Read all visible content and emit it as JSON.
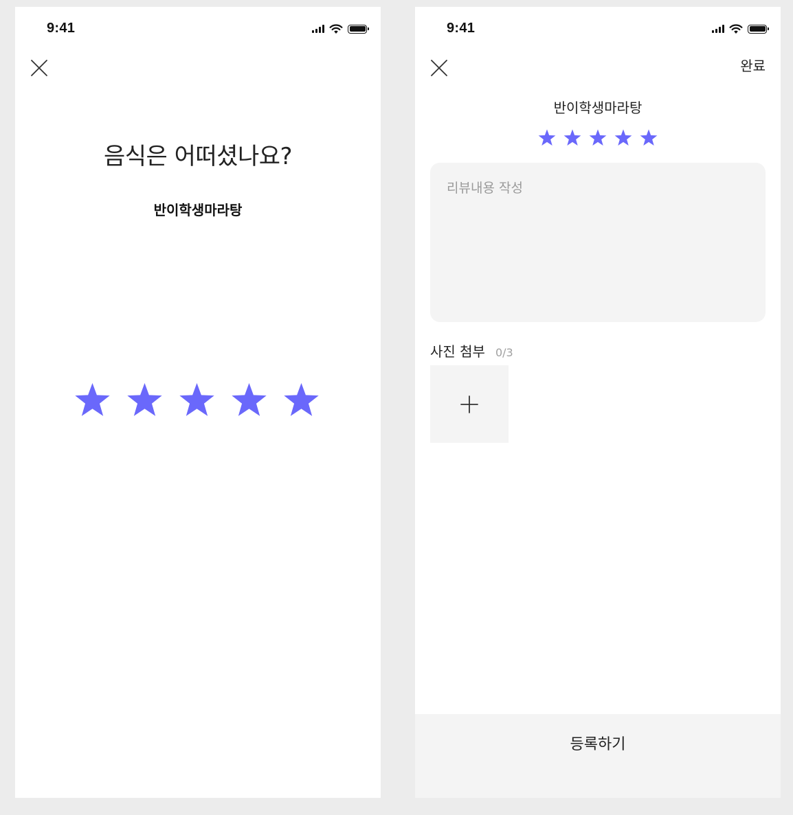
{
  "colors": {
    "star": "#6a68fb",
    "background": "#ececec",
    "surface": "#f4f4f4"
  },
  "left_screen": {
    "status_time": "9:41",
    "question": "음식은 어떠셨나요?",
    "store_name": "반이학생마라탕",
    "rating": 5,
    "max_rating": 5,
    "icons": [
      "close-icon",
      "star-icon",
      "cellular-signal-icon",
      "wifi-icon",
      "battery-icon"
    ]
  },
  "right_screen": {
    "status_time": "9:41",
    "done_label": "완료",
    "store_name": "반이학생마라탕",
    "rating": 5,
    "max_rating": 5,
    "review_placeholder": "리뷰내용 작성",
    "photo_label": "사진 첨부",
    "photo_count": "0/3",
    "submit_label": "등록하기",
    "icons": [
      "close-icon",
      "star-icon",
      "plus-icon",
      "cellular-signal-icon",
      "wifi-icon",
      "battery-icon"
    ]
  }
}
